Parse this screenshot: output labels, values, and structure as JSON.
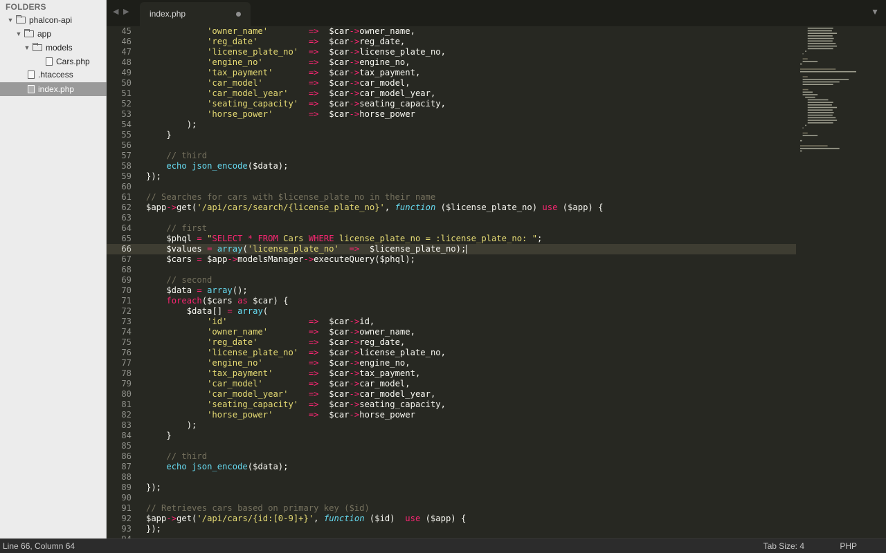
{
  "sidebar": {
    "header": "FOLDERS",
    "items": [
      {
        "label": "phalcon-api",
        "kind": "folder",
        "expanded": true
      },
      {
        "label": "app",
        "kind": "folder",
        "expanded": true
      },
      {
        "label": "models",
        "kind": "folder",
        "expanded": true
      },
      {
        "label": "Cars.php",
        "kind": "file"
      },
      {
        "label": ".htaccess",
        "kind": "file"
      },
      {
        "label": "index.php",
        "kind": "file",
        "selected": true
      }
    ]
  },
  "tabs": [
    {
      "label": "index.php",
      "active": true,
      "modified": true
    }
  ],
  "editor": {
    "current_line": 66,
    "lines": [
      {
        "n": "45",
        "code": "            'owner_name'        =>  $car->owner_name,"
      },
      {
        "n": "46",
        "code": "            'reg_date'          =>  $car->reg_date,"
      },
      {
        "n": "47",
        "code": "            'license_plate_no'  =>  $car->license_plate_no,"
      },
      {
        "n": "48",
        "code": "            'engine_no'         =>  $car->engine_no,"
      },
      {
        "n": "49",
        "code": "            'tax_payment'       =>  $car->tax_payment,"
      },
      {
        "n": "50",
        "code": "            'car_model'         =>  $car->car_model,"
      },
      {
        "n": "51",
        "code": "            'car_model_year'    =>  $car->car_model_year,"
      },
      {
        "n": "52",
        "code": "            'seating_capacity'  =>  $car->seating_capacity,"
      },
      {
        "n": "53",
        "code": "            'horse_power'       =>  $car->horse_power"
      },
      {
        "n": "54",
        "code": "        );"
      },
      {
        "n": "55",
        "code": "    }"
      },
      {
        "n": "56",
        "code": ""
      },
      {
        "n": "57",
        "code": "    // third"
      },
      {
        "n": "58",
        "code": "    echo json_encode($data);"
      },
      {
        "n": "59",
        "code": "});"
      },
      {
        "n": "60",
        "code": ""
      },
      {
        "n": "61",
        "code": "// Searches for cars with $license_plate_no in their name"
      },
      {
        "n": "62",
        "code": "$app->get('/api/cars/search/{license_plate_no}', function ($license_plate_no) use ($app) {"
      },
      {
        "n": "63",
        "code": ""
      },
      {
        "n": "64",
        "code": "    // first"
      },
      {
        "n": "65",
        "code": "    $phql = \"SELECT * FROM Cars WHERE license_plate_no = :license_plate_no: \";"
      },
      {
        "n": "66",
        "code": "    $values = array('license_plate_no'  =>  $license_plate_no);"
      },
      {
        "n": "67",
        "code": "    $cars = $app->modelsManager->executeQuery($phql);"
      },
      {
        "n": "68",
        "code": ""
      },
      {
        "n": "69",
        "code": "    // second"
      },
      {
        "n": "70",
        "code": "    $data = array();"
      },
      {
        "n": "71",
        "code": "    foreach($cars as $car) {"
      },
      {
        "n": "72",
        "code": "        $data[] = array("
      },
      {
        "n": "73",
        "code": "            'id'                =>  $car->id,"
      },
      {
        "n": "74",
        "code": "            'owner_name'        =>  $car->owner_name,"
      },
      {
        "n": "75",
        "code": "            'reg_date'          =>  $car->reg_date,"
      },
      {
        "n": "76",
        "code": "            'license_plate_no'  =>  $car->license_plate_no,"
      },
      {
        "n": "77",
        "code": "            'engine_no'         =>  $car->engine_no,"
      },
      {
        "n": "78",
        "code": "            'tax_payment'       =>  $car->tax_payment,"
      },
      {
        "n": "79",
        "code": "            'car_model'         =>  $car->car_model,"
      },
      {
        "n": "80",
        "code": "            'car_model_year'    =>  $car->car_model_year,"
      },
      {
        "n": "81",
        "code": "            'seating_capacity'  =>  $car->seating_capacity,"
      },
      {
        "n": "82",
        "code": "            'horse_power'       =>  $car->horse_power"
      },
      {
        "n": "83",
        "code": "        );"
      },
      {
        "n": "84",
        "code": "    }"
      },
      {
        "n": "85",
        "code": ""
      },
      {
        "n": "86",
        "code": "    // third"
      },
      {
        "n": "87",
        "code": "    echo json_encode($data);"
      },
      {
        "n": "88",
        "code": ""
      },
      {
        "n": "89",
        "code": "});"
      },
      {
        "n": "90",
        "code": ""
      },
      {
        "n": "91",
        "code": "// Retrieves cars based on primary key ($id)"
      },
      {
        "n": "92",
        "code": "$app->get('/api/cars/{id:[0-9]+}', function ($id)  use ($app) {"
      },
      {
        "n": "93",
        "code": "});"
      },
      {
        "n": "94",
        "code": ""
      }
    ]
  },
  "status": {
    "position": "Line 66, Column 64",
    "tab_size": "Tab Size: 4",
    "syntax": "PHP"
  },
  "colors": {
    "background": "#272822",
    "keyword": "#f92672",
    "string": "#e6db74",
    "comment": "#75715e",
    "function": "#66d9ef",
    "sidebar": "#ececec"
  }
}
